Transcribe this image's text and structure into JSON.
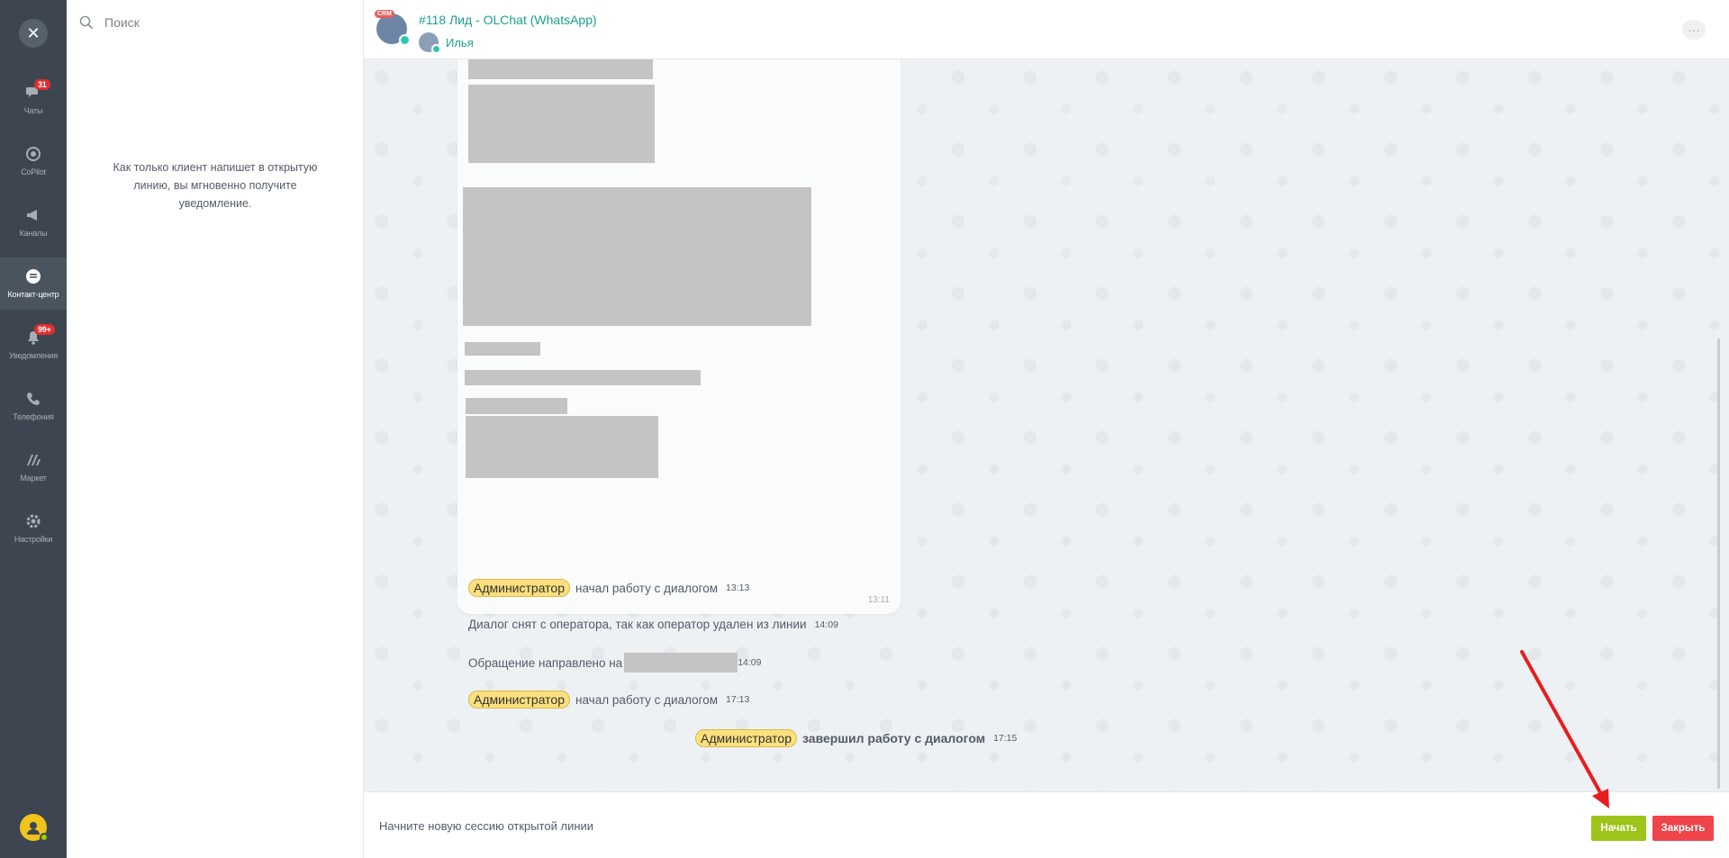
{
  "rail": {
    "close_icon": "close-icon",
    "items": [
      {
        "label": "Чаты",
        "icon": "chat-icon",
        "badge": "31"
      },
      {
        "label": "CoPilot",
        "icon": "copilot-icon",
        "badge": ""
      },
      {
        "label": "Каналы",
        "icon": "megaphone-icon",
        "badge": ""
      },
      {
        "label": "Контакт-центр",
        "icon": "contact-center-icon",
        "badge": "",
        "active": true
      },
      {
        "label": "Уведомления",
        "icon": "bell-icon",
        "badge": "99+"
      },
      {
        "label": "Телефония",
        "icon": "phone-icon",
        "badge": ""
      },
      {
        "label": "Маркет",
        "icon": "market-icon",
        "badge": ""
      },
      {
        "label": "Настройки",
        "icon": "gear-icon",
        "badge": ""
      }
    ]
  },
  "list": {
    "search_placeholder": "Поиск",
    "empty_note": "Как только клиент напишет в открытую линию, вы мгновенно получите уведомление."
  },
  "header": {
    "title": "#118 Лид - OLChat (WhatsApp)",
    "crm_badge": "CRM",
    "operator": "Илья",
    "more": "···"
  },
  "messages": {
    "card_time": "13:11",
    "system": [
      {
        "user": "Администратор",
        "text": "начал работу с диалогом",
        "time": "13:13"
      },
      {
        "user": "",
        "text": "Диалог снят с оператора, так как оператор удален из линии",
        "time": "14:09"
      },
      {
        "user": "",
        "text": "Обращение направлено на",
        "time": "14:09"
      },
      {
        "user": "Администратор",
        "text": "начал работу с диалогом",
        "time": "17:13"
      }
    ],
    "finished": {
      "user": "Администратор",
      "text": "завершил работу с диалогом",
      "time": "17:15"
    }
  },
  "footer": {
    "hint": "Начните новую сессию открытой линии",
    "start_label": "Начать",
    "close_label": "Закрыть"
  },
  "colors": {
    "accent": "#1e9f91",
    "start_button": "#9dc41a",
    "close_button": "#f0444b",
    "annotation_arrow": "#e81e1e"
  }
}
